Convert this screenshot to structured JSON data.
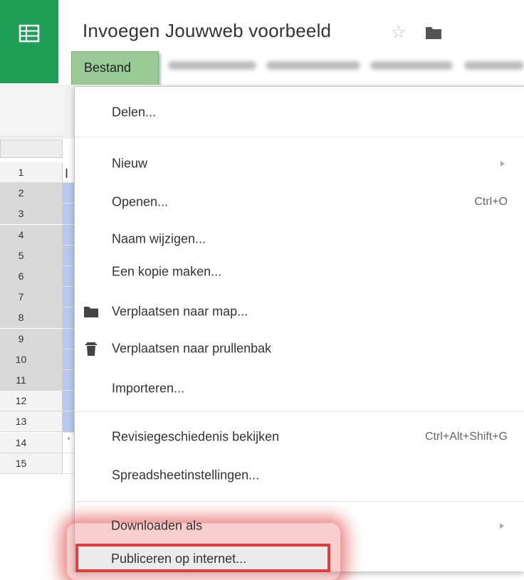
{
  "header": {
    "doc_title": "Invoegen Jouwweb voorbeeld",
    "app_icon": "sheets-grid-icon",
    "star_icon": "star-icon",
    "folder_icon": "folder-icon",
    "brand_color": "#1f9f55"
  },
  "menubar": {
    "active_menu": "Bestand",
    "active_color": "#9acb97"
  },
  "rows": [
    "1",
    "2",
    "3",
    "4",
    "5",
    "6",
    "7",
    "8",
    "9",
    "10",
    "11",
    "12",
    "13",
    "14",
    "15"
  ],
  "selected_rows": [
    "2",
    "3",
    "4",
    "5",
    "6",
    "7",
    "8",
    "9",
    "10",
    "11"
  ],
  "file_menu": {
    "items": {
      "delen": "Delen...",
      "nieuw": "Nieuw",
      "openen": "Openen...",
      "openen_shortcut": "Ctrl+O",
      "naam": "Naam wijzigen...",
      "kopie": "Een kopie maken...",
      "verplaatsen_map": "Verplaatsen naar map...",
      "verplaatsen_prullenbak": "Verplaatsen naar prullenbak",
      "importeren": "Importeren...",
      "revisie": "Revisiegeschiedenis bekijken",
      "revisie_shortcut": "Ctrl+Alt+Shift+G",
      "instellingen": "Spreadsheetinstellingen...",
      "downloaden": "Downloaden als",
      "publiceren": "Publiceren op internet..."
    },
    "highlight_color": "#e23b3b"
  }
}
